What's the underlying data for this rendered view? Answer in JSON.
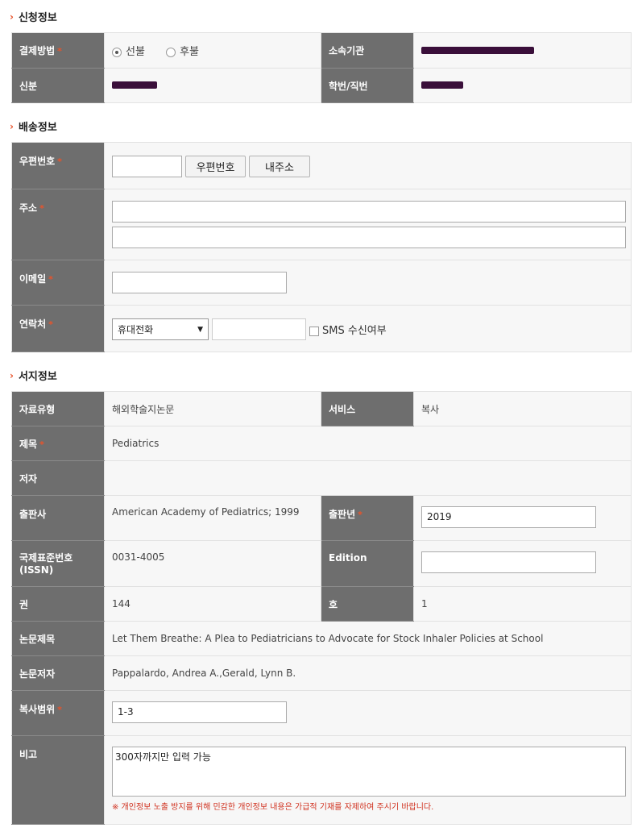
{
  "sections": {
    "apply_title": "신청정보",
    "delivery_title": "배송정보",
    "book_title": "서지정보"
  },
  "apply": {
    "payment_label": "결제방법",
    "payment_options": [
      "선불",
      "후불"
    ],
    "payment_selected": "선불",
    "affiliation_label": "소속기관",
    "status_label": "신분",
    "student_id_label": "학번/직번"
  },
  "delivery": {
    "zip_label": "우편번호",
    "zip_value": "",
    "zip_search_button": "우편번호",
    "my_address_button": "내주소",
    "address_label": "주소",
    "address_line1": "",
    "address_line2": "",
    "email_label": "이메일",
    "email_value": "",
    "contact_label": "연락처",
    "phone_type_selected": "휴대전화",
    "phone_value": "",
    "sms_label": "SMS 수신여부"
  },
  "book": {
    "type_label": "자료유형",
    "type_value": "해외학술지논문",
    "service_label": "서비스",
    "service_value": "복사",
    "title_label": "제목",
    "title_value": "Pediatrics",
    "author_label": "저자",
    "author_value": "",
    "publisher_label": "출판사",
    "publisher_value": "American Academy of Pediatrics; 1999",
    "pub_year_label": "출판년",
    "pub_year_value": "2019",
    "issn_label_line1": "국제표준번호",
    "issn_label_line2": "(ISSN)",
    "issn_value": "0031-4005",
    "edition_label": "Edition",
    "edition_value": "",
    "volume_label": "권",
    "volume_value": "144",
    "issue_label": "호",
    "issue_value": "1",
    "article_title_label": "논문제목",
    "article_title_value": "Let Them Breathe: A Plea to Pediatricians to Advocate for Stock Inhaler Policies at School",
    "article_author_label": "논문저자",
    "article_author_value": "Pappalardo, Andrea A.,Gerald, Lynn B.",
    "copy_range_label": "복사범위",
    "copy_range_value": "1-3",
    "memo_label": "비고",
    "memo_placeholder": "300자까지만 입력 가능",
    "memo_notice": "※ 개인정보 노출 방지를 위해 민감한 개인정보 내용은 가급적 기재를 자제하여 주시기 바랍니다."
  },
  "required_mark": "*"
}
